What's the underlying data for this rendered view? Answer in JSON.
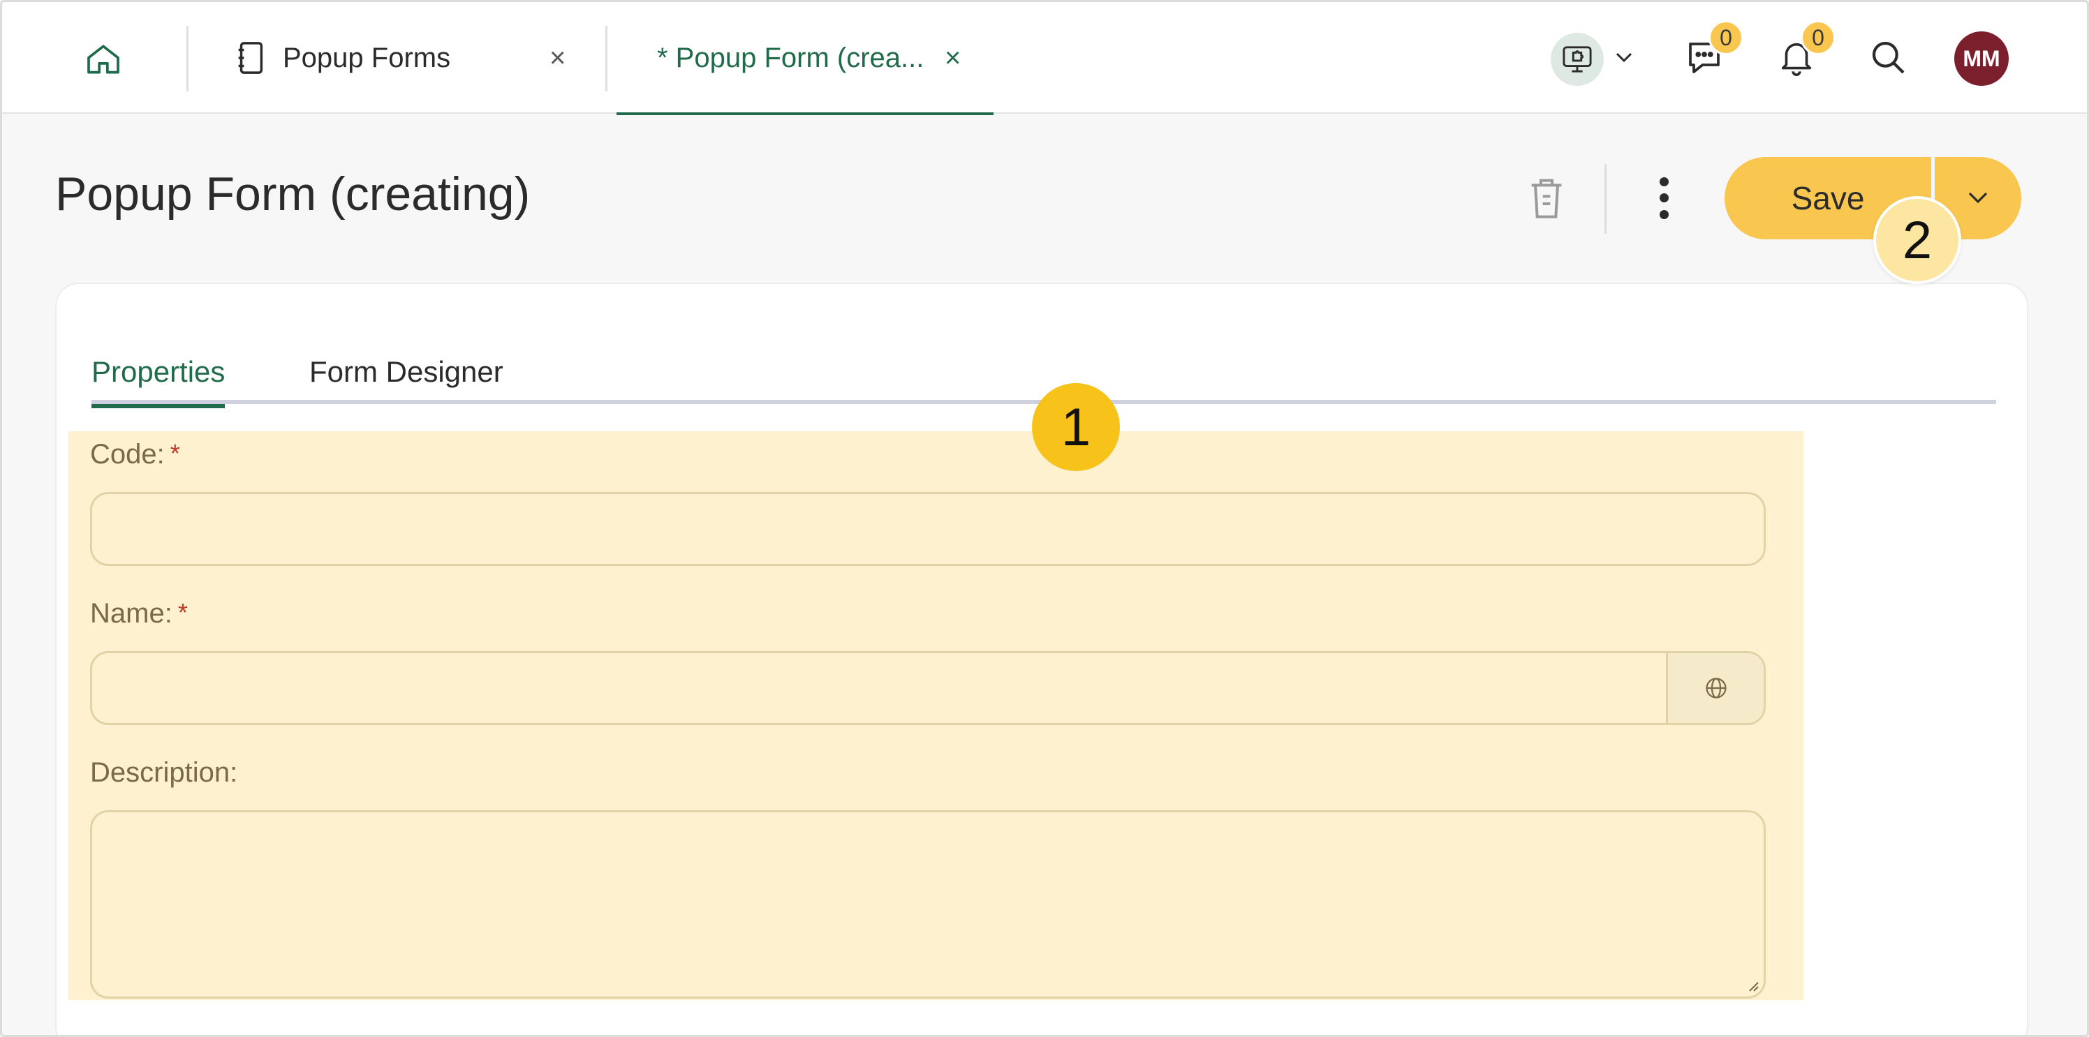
{
  "topbar": {
    "tabs": [
      {
        "label": "Popup Forms",
        "close": "×"
      },
      {
        "label": "* Popup Form (crea...",
        "close": "×"
      }
    ],
    "chat_badge": "0",
    "notifications_badge": "0",
    "avatar_initials": "MM"
  },
  "page": {
    "title": "Popup Form (creating)",
    "save_label": "Save"
  },
  "card": {
    "tabs": [
      "Properties",
      "Form Designer"
    ],
    "fields": {
      "code_label": "Code:",
      "name_label": "Name:",
      "description_label": "Description:",
      "required_mark": "*",
      "code_value": "",
      "name_value": "",
      "description_value": ""
    }
  },
  "callouts": [
    "1",
    "2"
  ],
  "colors": {
    "accent_green": "#1f6b4a",
    "save_yellow": "#f9c74f",
    "highlight": "#fdf1cf",
    "avatar": "#7a1f2b"
  }
}
